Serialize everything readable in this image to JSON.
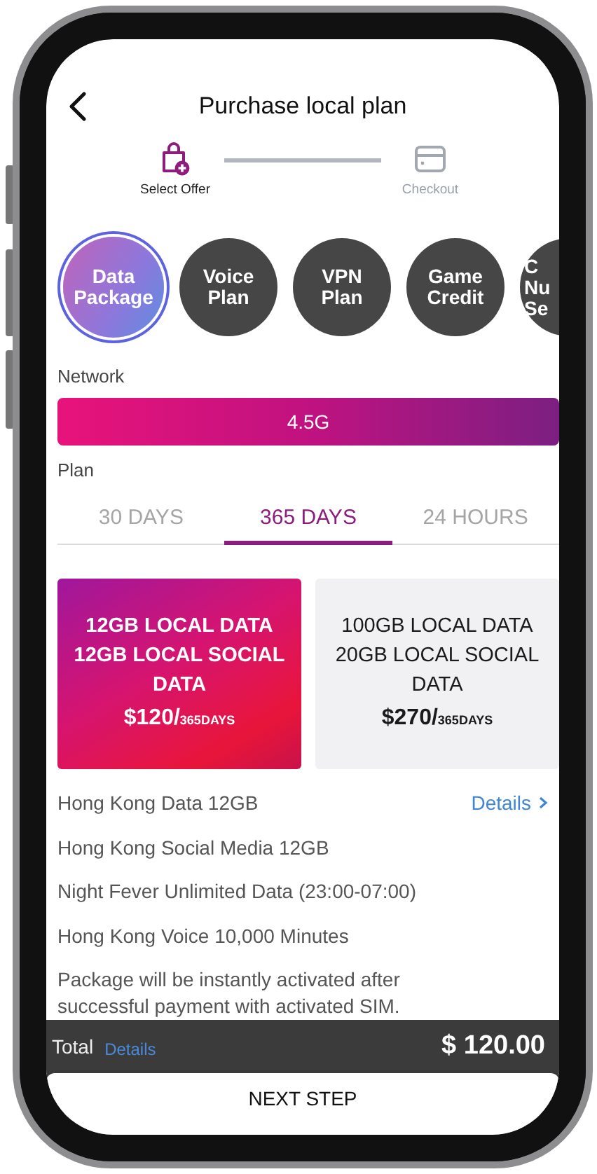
{
  "header": {
    "title": "Purchase local plan"
  },
  "steps": [
    {
      "label": "Select Offer",
      "selected": true,
      "kind": "offer"
    },
    {
      "label": "Checkout",
      "selected": false,
      "kind": "checkout"
    }
  ],
  "categories": [
    {
      "lines": [
        "Data",
        "Package"
      ],
      "selected": true,
      "kind": "full"
    },
    {
      "lines": [
        "Voice",
        "Plan"
      ],
      "selected": false,
      "kind": "full"
    },
    {
      "lines": [
        "VPN",
        "Plan"
      ],
      "selected": false,
      "kind": "full"
    },
    {
      "lines": [
        "Game",
        "Credit"
      ],
      "selected": false,
      "kind": "full"
    },
    {
      "lines": [
        "C",
        "Nu",
        "Se"
      ],
      "selected": false,
      "kind": "partial"
    }
  ],
  "network": {
    "label": "Network",
    "value": "4.5G"
  },
  "plan": {
    "label": "Plan",
    "tabs": [
      {
        "label": "30 DAYS",
        "selected": false
      },
      {
        "label": "365 DAYS",
        "selected": true
      },
      {
        "label": "24 HOURS",
        "selected": false
      }
    ]
  },
  "offers": [
    {
      "title": "12GB LOCAL DATA 12GB LOCAL SOCIAL DATA",
      "price": "$120/",
      "period": "365DAYS",
      "selected": true
    },
    {
      "title": "100GB LOCAL DATA 20GB LOCAL SOCIAL DATA",
      "price": "$270/",
      "period": "365DAYS",
      "selected": false
    }
  ],
  "details": {
    "items": [
      "Hong Kong Data 12GB",
      "Hong Kong Social Media 12GB",
      "Night Fever Unlimited Data (23:00-07:00)",
      "Hong Kong Voice 10,000 Minutes"
    ],
    "link": "Details",
    "note": "Package will be instantly activated after successful payment with activated SIM."
  },
  "total": {
    "label": "Total",
    "link": "Details",
    "amount": "$ 120.00"
  },
  "next_button": "NEXT STEP"
}
